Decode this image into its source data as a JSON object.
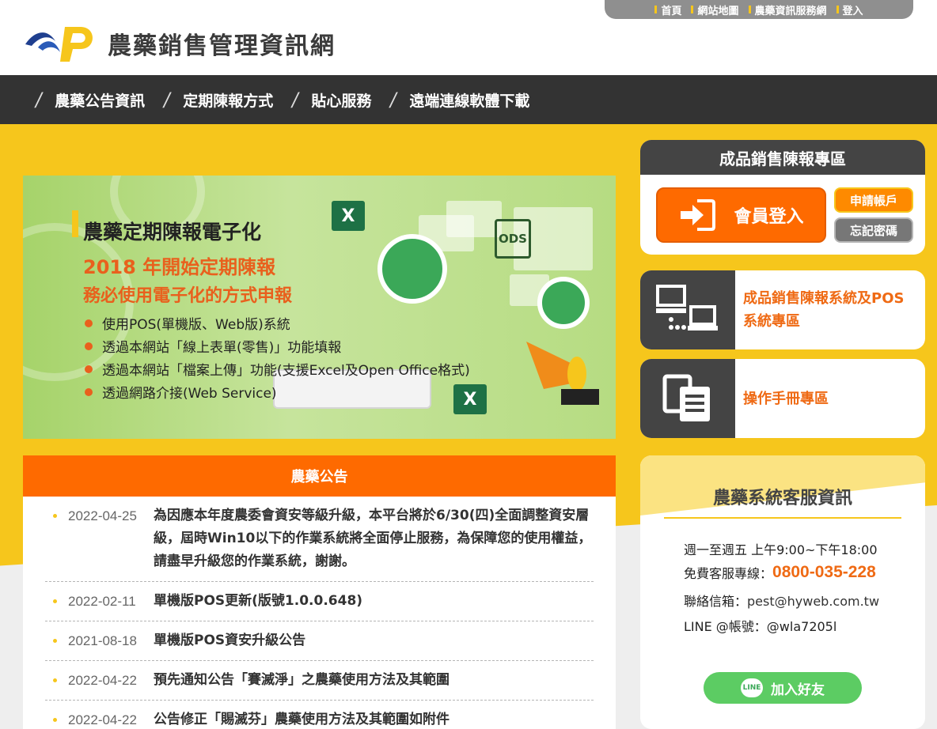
{
  "header": {
    "site_title": "農藥銷售管理資訊網",
    "util_links": [
      "首頁",
      "網站地圖",
      "農藥資訊服務網",
      "登入"
    ]
  },
  "nav": {
    "items": [
      "農藥公告資訊",
      "定期陳報方式",
      "貼心服務",
      "遠端連線軟體下載"
    ]
  },
  "banner": {
    "title": "農藥定期陳報電子化",
    "subtitle1": "2018 年開始定期陳報",
    "subtitle2": "務必使用電子化的方式申報",
    "bullets": [
      "使用POS(單機版、Web版)系統",
      "透過本網站「線上表單(零售)」功能填報",
      "透過本網站「檔案上傳」功能(支援Excel及Open Office格式)",
      "透過網路介接(Web Service)"
    ],
    "excel_mark": "X",
    "ods_mark": "ODS"
  },
  "news": {
    "title": "農藥公告",
    "items": [
      {
        "date": "2022-04-25",
        "text": "為因應本年度農委會資安等級升級，本平台將於6/30(四)全面調整資安層級，屆時Win10以下的作業系統將全面停止服務，為保障您的使用權益，請盡早升級您的作業系統，謝謝。"
      },
      {
        "date": "2022-02-11",
        "text": "單機版POS更新(版號1.0.0.648)"
      },
      {
        "date": "2021-08-18",
        "text": "單機版POS資安升級公告"
      },
      {
        "date": "2022-04-22",
        "text": "預先通知公告「賽滅淨」之農藥使用方法及其範圍"
      },
      {
        "date": "2022-04-22",
        "text": "公告修正「賜滅芬」農藥使用方法及其範圍如附件"
      }
    ]
  },
  "report": {
    "title": "成品銷售陳報專區",
    "login_label": "會員登入",
    "apply_label": "申請帳戶",
    "forgot_label": "忘記密碼"
  },
  "links": {
    "pos_label": "成品銷售陳報系統及POS系統專區",
    "manual_label": "操作手冊專區"
  },
  "service": {
    "title": "農藥系統客服資訊",
    "hours": "週一至週五 上午9:00~下午18:00",
    "phone_label": "免費客服專線：",
    "phone": "0800-035-228",
    "mail_label": "聯絡信箱：",
    "mail": "pest@hyweb.com.tw",
    "line_label": "LINE @帳號：@wla7205l",
    "line_button": "加入好友",
    "line_badge": "LINE"
  },
  "colors": {
    "accent_orange": "#fe6a00",
    "brand_yellow": "#f6c61c",
    "nav_dark": "#333333"
  }
}
